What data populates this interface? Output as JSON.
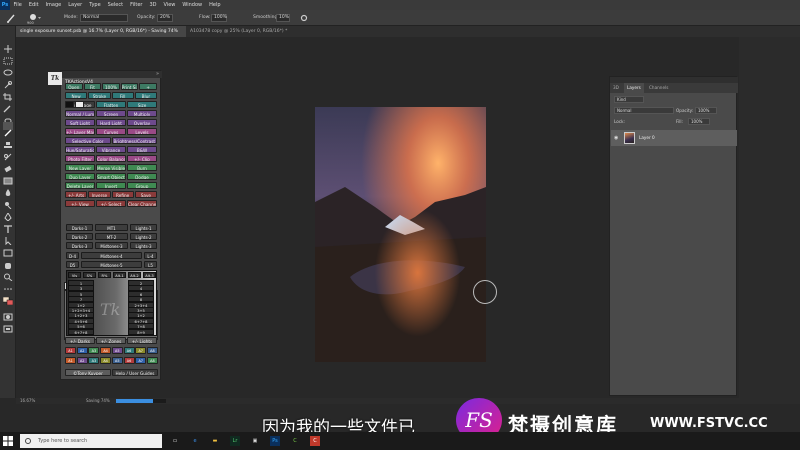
{
  "menu": [
    "File",
    "Edit",
    "Image",
    "Layer",
    "Type",
    "Select",
    "Filter",
    "3D",
    "View",
    "Window",
    "Help"
  ],
  "app_icon": "Ps",
  "options": {
    "brush_size": "900",
    "mode_label": "Mode:",
    "mode": "Normal",
    "opacity_label": "Opacity:",
    "opacity": "20%",
    "flow_label": "Flow:",
    "flow": "100%",
    "smoothing_label": "Smoothing:",
    "smoothing": "10%"
  },
  "tabs": [
    "single exposure sunset.psb @ 16.7% (Layer 0, RGB/16*) - Saving 74%",
    "A103478 copy @ 25% (Layer 0, RGB/16*) *"
  ],
  "tk": {
    "title": "TKActionsV4",
    "logo": "Tk",
    "rows": [
      [
        "Open",
        "Fit",
        "100%",
        "Print Size",
        "+"
      ],
      [
        "New",
        "Stroke",
        "Fill",
        "Blur"
      ],
      [
        "Dup Image",
        "Flatten",
        "Size"
      ],
      [
        "Normal / Lum",
        "Screen",
        "Multiply"
      ],
      [
        "Soft Light",
        "Hard Light",
        "Overlay"
      ],
      [
        "+/- Layer Mask",
        "Curves",
        "Levels"
      ],
      [
        "Selective Color",
        "Brightness/Contrast"
      ],
      [
        "Hue/Saturation",
        "Vibrance",
        "B&W"
      ],
      [
        "Photo Filter",
        "Color Balance",
        "+/- Clip"
      ],
      [
        "New Layer",
        "Merge Visible",
        "Burn"
      ],
      [
        "Dup Layer",
        "Smart Object",
        "Dodge"
      ],
      [
        "Delete Layer",
        "Invert",
        "Group"
      ],
      [
        "+/- Arts",
        "Inverse",
        "Refine",
        "Save"
      ],
      [
        "+/- View",
        "+/- Select",
        "Clear Channels"
      ]
    ],
    "subtabs": [
      "Spectrum",
      "Actions",
      "Basic"
    ],
    "spectrum": {
      "row1": [
        "Darks-1",
        "MT1",
        "Lights-1"
      ],
      "row2": [
        "Darks-2",
        "MT-2",
        "Lights-2"
      ],
      "row3": [
        "Darks-3",
        "Midtones-3",
        "Lights-3"
      ],
      "row4": [
        "D-4",
        "Midtones-4",
        "L-4"
      ],
      "row5": [
        "D5",
        "Midtones-5",
        "L5"
      ],
      "grid_top": [
        "Vis",
        "S%",
        "R%",
        "Alt-1",
        "Alt-2",
        "Alt-3"
      ],
      "grid": [
        "1",
        "2",
        "3",
        "4",
        "5",
        "6",
        "7",
        "8",
        "1+2",
        "2+3+4",
        "1+2+3+4",
        "3+5",
        "1+2+3",
        "1+2",
        "4+5+6",
        "6+7+8",
        "5+6",
        "7+8",
        "6+7+8",
        "8+9"
      ],
      "watermark": "Tk"
    },
    "bottom": [
      "+/- Darks",
      "+/- Zones",
      "+/- Lights"
    ],
    "chips": [
      "A1",
      "A2",
      "A3",
      "A4",
      "A5",
      "A6",
      "A7",
      "A8"
    ],
    "chip_colors": [
      "#b23b3b",
      "#2f5fa8",
      "#3f8a52",
      "#c25a2a",
      "#6d4a8c",
      "#2f7a7a",
      "#8a8a2a",
      "#3b5f8f"
    ],
    "footer": [
      "©Tony Kuyper",
      "Help / User Guides"
    ]
  },
  "layers": {
    "tabs": [
      "3D",
      "Layers",
      "Channels"
    ],
    "kind": "Kind",
    "blend": "Normal",
    "opacity_label": "Opacity:",
    "opacity": "100%",
    "lock_label": "Lock:",
    "fill_label": "Fill:",
    "fill": "100%",
    "layer_name": "Layer 0"
  },
  "status": {
    "zoom": "16.67%",
    "save": "Saving 74%",
    "progress": 0.74
  },
  "subtitle": "因为我的一些文件已",
  "watermark": {
    "logo": "FS",
    "text": "梵摄创意库",
    "url": "WWW.FSTVC.CC"
  },
  "taskbar": {
    "search_placeholder": "Type here to search"
  }
}
